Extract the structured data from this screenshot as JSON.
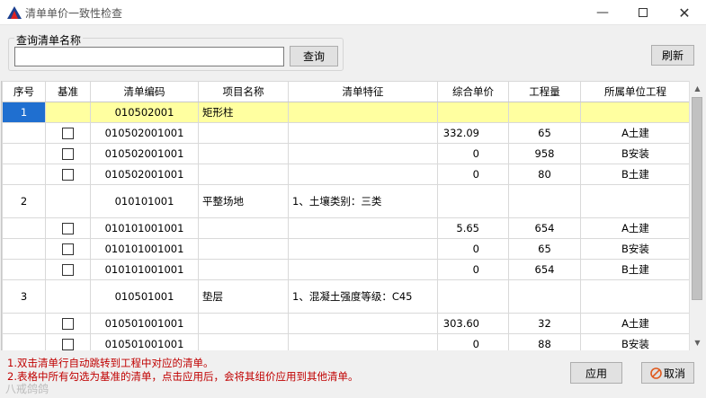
{
  "window": {
    "title": "清单单价一致性检查"
  },
  "query": {
    "group_label": "查询清单名称",
    "input_value": "",
    "search_label": "查询"
  },
  "toolbar": {
    "refresh_label": "刷新"
  },
  "table": {
    "headers": [
      "序号",
      "基准",
      "清单编码",
      "项目名称",
      "清单特征",
      "综合单价",
      "工程量",
      "所属单位工程"
    ],
    "rows": [
      {
        "type": "main",
        "seq": "1",
        "code": "010502001",
        "name": "矩形柱",
        "feature": "",
        "price": "",
        "qty": "",
        "unit": "",
        "highlight": true
      },
      {
        "type": "sub",
        "code": "010502001001",
        "price": "332.09",
        "qty": "65",
        "unit": "A土建"
      },
      {
        "type": "sub",
        "code": "010502001001",
        "price": "0",
        "qty": "958",
        "unit": "B安装"
      },
      {
        "type": "sub",
        "code": "010502001001",
        "price": "0",
        "qty": "80",
        "unit": "B土建"
      },
      {
        "type": "main",
        "seq": "2",
        "code": "010101001",
        "name": "平整场地",
        "feature": "1、土壤类别：三类",
        "price": "",
        "qty": "",
        "unit": ""
      },
      {
        "type": "sub",
        "code": "010101001001",
        "price": "5.65",
        "qty": "654",
        "unit": "A土建"
      },
      {
        "type": "sub",
        "code": "010101001001",
        "price": "0",
        "qty": "65",
        "unit": "B安装"
      },
      {
        "type": "sub",
        "code": "010101001001",
        "price": "0",
        "qty": "654",
        "unit": "B土建"
      },
      {
        "type": "main",
        "seq": "3",
        "code": "010501001",
        "name": "垫层",
        "feature": "1、混凝土强度等级：C45",
        "price": "",
        "qty": "",
        "unit": ""
      },
      {
        "type": "sub",
        "code": "010501001001",
        "price": "303.60",
        "qty": "32",
        "unit": "A土建"
      },
      {
        "type": "sub",
        "code": "010501001001",
        "price": "0",
        "qty": "88",
        "unit": "B安装"
      }
    ]
  },
  "notes": {
    "line1": "1.双击清单行自动跳转到工程中对应的清单。",
    "line2": "2.表格中所有勾选为基准的清单，点击应用后，会将其组价应用到其他清单。"
  },
  "footer": {
    "apply_label": "应用",
    "cancel_label": "取消"
  },
  "watermark": {
    "text": "八戒鸽鸽"
  },
  "colors": {
    "highlight_row": "#ffffa0",
    "selected_seq": "#1f6fd0",
    "note_text": "#c00000",
    "cancel_icon": "#e05a1e"
  }
}
